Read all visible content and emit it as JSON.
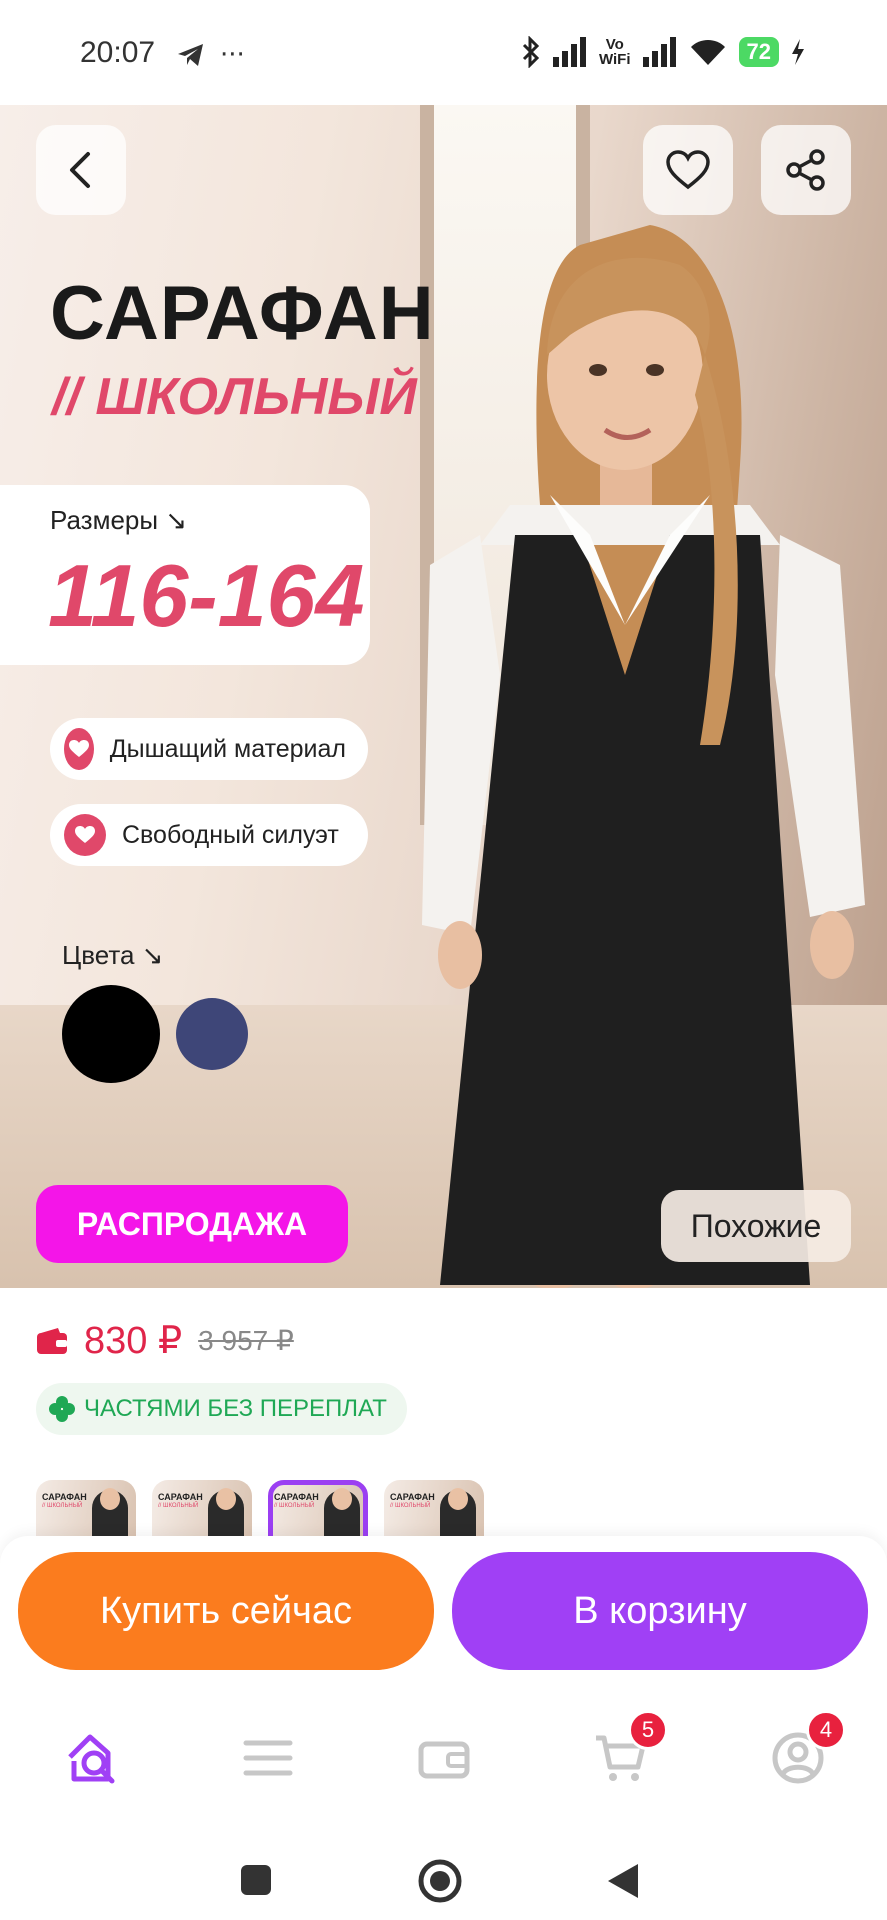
{
  "status_bar": {
    "time": "20:07",
    "vowifi_top": "Vo",
    "vowifi_bottom": "WiFi",
    "battery": "72"
  },
  "hero": {
    "title": "САРАФАН",
    "subtitle": "// ШКОЛЬНЫЙ",
    "sizes_label": "Размеры ↘",
    "sizes_value": "116-164",
    "features": [
      "Дышащий материал",
      "Свободный силуэт"
    ],
    "colors_label": "Цвета ↘",
    "swatches": [
      "#000000",
      "#3e4678"
    ],
    "sale_badge": "РАСПРОДАЖА",
    "similar_button": "Похожие"
  },
  "price": {
    "current": "830 ₽",
    "old": "3 957 ₽",
    "installment": "ЧАСТЯМИ БЕЗ ПЕРЕПЛАТ"
  },
  "thumbnails": [
    {
      "title": "САРАФАН",
      "sub": "// ШКОЛЬНЫЙ",
      "active": false
    },
    {
      "title": "САРАФАН",
      "sub": "// ШКОЛЬНЫЙ",
      "active": false
    },
    {
      "title": "САРАФАН",
      "sub": "// ШКОЛЬНЫЙ",
      "active": true
    },
    {
      "title": "САРАФАН",
      "sub": "// ШКОЛЬНЫЙ",
      "active": false
    }
  ],
  "actions": {
    "buy_now": "Купить сейчас",
    "add_to_cart": "В корзину"
  },
  "bottom_nav": {
    "cart_badge": "5",
    "profile_badge": "4"
  },
  "colors": {
    "accent_pink": "#e0486a",
    "sale_magenta": "#f415e8",
    "buy_orange": "#fb7c1e",
    "cart_purple": "#a040f5",
    "nav_active": "#a040f5"
  }
}
